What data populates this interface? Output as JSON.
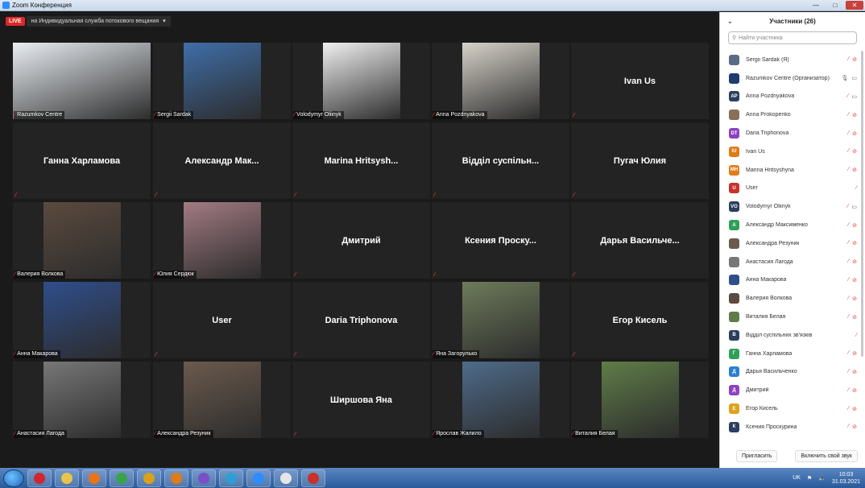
{
  "window": {
    "title": "Zoom Конференция"
  },
  "live": {
    "badge": "LIVE",
    "stream": "на Индивидуальная служба потокового вещания"
  },
  "tiles": [
    {
      "name": "Razumkov Centre",
      "type": "video",
      "active": true,
      "bg": "#e9eef3"
    },
    {
      "name": "Sergii Sardak",
      "type": "video",
      "bg": "#3f6ea8"
    },
    {
      "name": "Volodymyr Oliinyk",
      "type": "video",
      "bg": "#f0f0f0"
    },
    {
      "name": "Anna Pozdnyakova",
      "type": "video",
      "bg": "#d7d2c9"
    },
    {
      "name": "Ivan Us",
      "type": "text"
    },
    {
      "name": "Ганна Харламова",
      "type": "text"
    },
    {
      "name": "Александр Мак...",
      "type": "text"
    },
    {
      "name": "Marina Hritsysh...",
      "type": "text"
    },
    {
      "name": "Відділ суспільн...",
      "type": "text"
    },
    {
      "name": "Пугач Юлия",
      "type": "text"
    },
    {
      "name": "Валерия Волкова",
      "type": "video",
      "bg": "#5b4a3e"
    },
    {
      "name": "Юлия Сердюк",
      "type": "video",
      "bg": "#a27b83"
    },
    {
      "name": "Дмитрий",
      "type": "text"
    },
    {
      "name": "Ксения Проску...",
      "type": "text"
    },
    {
      "name": "Дарья Васильче...",
      "type": "text"
    },
    {
      "name": "Анна Макарова",
      "type": "video",
      "bg": "#2f4e8c"
    },
    {
      "name": "User",
      "type": "text"
    },
    {
      "name": "Daria Triphonova",
      "type": "text"
    },
    {
      "name": "Яна Загорулько",
      "type": "video",
      "bg": "#6d7b5a"
    },
    {
      "name": "Егор Кисель",
      "type": "text"
    },
    {
      "name": "Анастасия Лагода",
      "type": "video",
      "bg": "#777777"
    },
    {
      "name": "Александра Резуник",
      "type": "video",
      "bg": "#6b5a4d"
    },
    {
      "name": "Ширшова Яна",
      "type": "text"
    },
    {
      "name": "Ярослав Жалило",
      "type": "video",
      "bg": "#4e6b8a"
    },
    {
      "name": "Виталия Белая",
      "type": "video",
      "bg": "#5f7d48"
    }
  ],
  "panel": {
    "title": "Участники (26)",
    "search_placeholder": "Найти участника",
    "invite": "Пригласить",
    "unmute_me": "Включить свой звук",
    "participants": [
      {
        "name": "Sergii Sardak (Я)",
        "initials": "",
        "color": "#5a6b85",
        "mic": "off",
        "video": "off"
      },
      {
        "name": "Razumkov Centre (Организатор)",
        "initials": "",
        "color": "#1e3c6e",
        "mic": "on",
        "video": "on"
      },
      {
        "name": "Anna Pozdnyakova",
        "initials": "AP",
        "color": "#2a3f5e",
        "mic": "off",
        "video": "on"
      },
      {
        "name": "Anna Prokopenko",
        "initials": "",
        "color": "#8a6f5a",
        "mic": "off",
        "video": "off"
      },
      {
        "name": "Daria Triphonova",
        "initials": "DT",
        "color": "#8e3fc2",
        "mic": "off",
        "video": "off"
      },
      {
        "name": "Ivan Us",
        "initials": "IU",
        "color": "#e07b1a",
        "mic": "off",
        "video": "off"
      },
      {
        "name": "Marina Hritsyshyna",
        "initials": "MH",
        "color": "#e07b1a",
        "mic": "off",
        "video": "off"
      },
      {
        "name": "User",
        "initials": "U",
        "color": "#c8322c",
        "mic": "off",
        "video": ""
      },
      {
        "name": "Volodymyr Oliinyk",
        "initials": "VO",
        "color": "#2a3f5e",
        "mic": "off",
        "video": "on"
      },
      {
        "name": "Александр Максименко",
        "initials": "A",
        "color": "#2fa05a",
        "mic": "off",
        "video": "off"
      },
      {
        "name": "Александра Резуник",
        "initials": "",
        "color": "#6b5a4d",
        "mic": "off",
        "video": "off"
      },
      {
        "name": "Анастасия Лагода",
        "initials": "",
        "color": "#777777",
        "mic": "off",
        "video": "off"
      },
      {
        "name": "Анна Макарова",
        "initials": "",
        "color": "#2f4e8c",
        "mic": "off",
        "video": "off"
      },
      {
        "name": "Валерия Волкова",
        "initials": "",
        "color": "#5b4a3e",
        "mic": "off",
        "video": "off"
      },
      {
        "name": "Виталия Белая",
        "initials": "",
        "color": "#5f7d48",
        "mic": "off",
        "video": "off"
      },
      {
        "name": "Відділ суспільних зв'язків",
        "initials": "В",
        "color": "#2a3f5e",
        "mic": "off",
        "video": ""
      },
      {
        "name": "Ганна Харламова",
        "initials": "Г",
        "color": "#2fa05a",
        "mic": "off",
        "video": "off"
      },
      {
        "name": "Дарья Васильченко",
        "initials": "Д",
        "color": "#2d7fd1",
        "mic": "off",
        "video": "off"
      },
      {
        "name": "Дмитрий",
        "initials": "Д",
        "color": "#8e3fc2",
        "mic": "off",
        "video": "off"
      },
      {
        "name": "Егор Кисель",
        "initials": "Е",
        "color": "#e0a21a",
        "mic": "off",
        "video": "off"
      },
      {
        "name": "Ксения Проскурина",
        "initials": "К",
        "color": "#2a3f5e",
        "mic": "off",
        "video": "off"
      }
    ]
  },
  "taskbar": {
    "lang": "UK",
    "time": "10:03",
    "date": "31.03.2021",
    "apps": [
      {
        "name": "opera-icon",
        "color": "#d0262f"
      },
      {
        "name": "file-explorer-icon",
        "color": "#e8c44a"
      },
      {
        "name": "firefox-icon",
        "color": "#e8731a"
      },
      {
        "name": "chrome-icon",
        "color": "#3aa34a"
      },
      {
        "name": "chrome-alt-icon",
        "color": "#d9a21a"
      },
      {
        "name": "media-player-icon",
        "color": "#e07b1a"
      },
      {
        "name": "viber-icon",
        "color": "#7b4fc8"
      },
      {
        "name": "edge-icon",
        "color": "#2d9fd6"
      },
      {
        "name": "zoom-icon",
        "color": "#2d8cff"
      },
      {
        "name": "document-icon",
        "color": "#e6e6e6"
      },
      {
        "name": "acrobat-icon",
        "color": "#c8322c"
      }
    ]
  }
}
